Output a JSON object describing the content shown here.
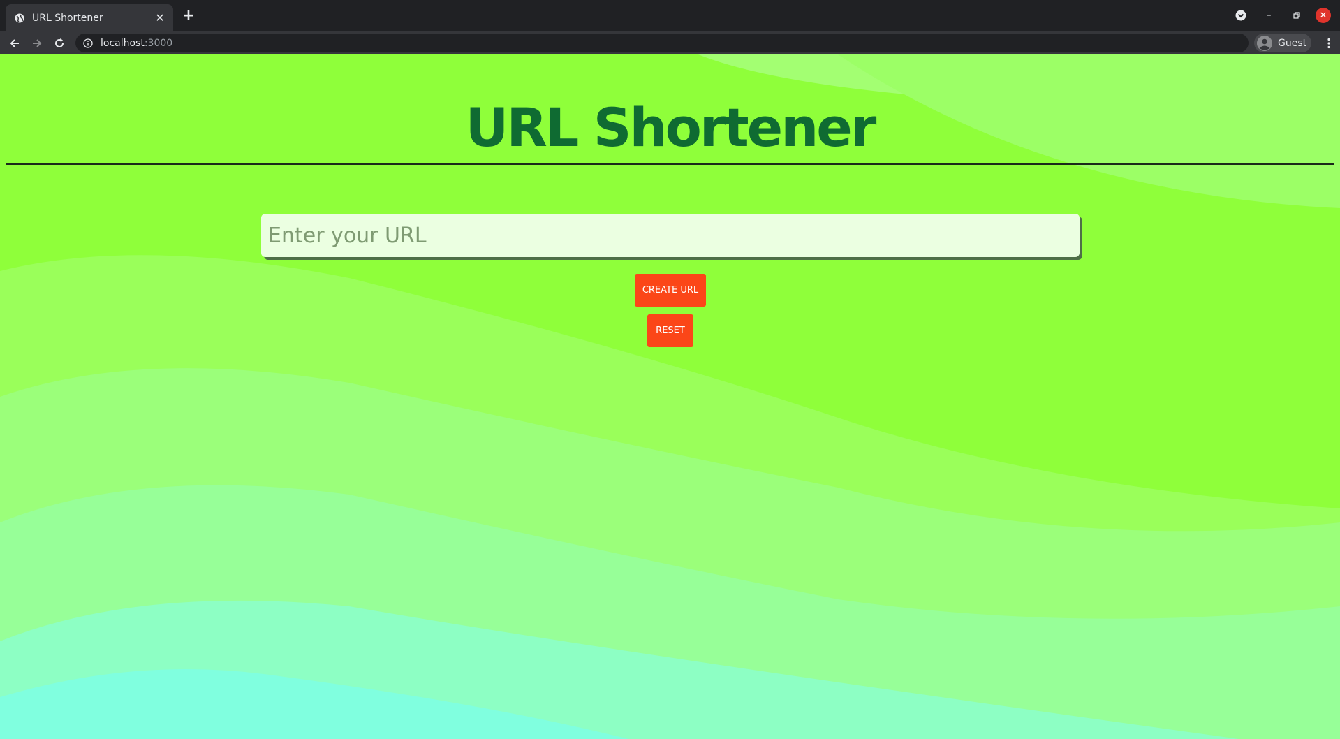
{
  "browser": {
    "tab_title": "URL Shortener",
    "address_host": "localhost",
    "address_port": ":3000",
    "profile_label": "Guest"
  },
  "page": {
    "heading": "URL Shortener",
    "input_placeholder": "Enter your URL",
    "create_button": "CREATE URL",
    "reset_button": "RESET"
  },
  "colors": {
    "heading": "#0f6b32",
    "button": "#fb4618",
    "input_bg": "#ebffe1",
    "page_green": "#8fff3a",
    "page_cyan": "#80ffdf"
  }
}
